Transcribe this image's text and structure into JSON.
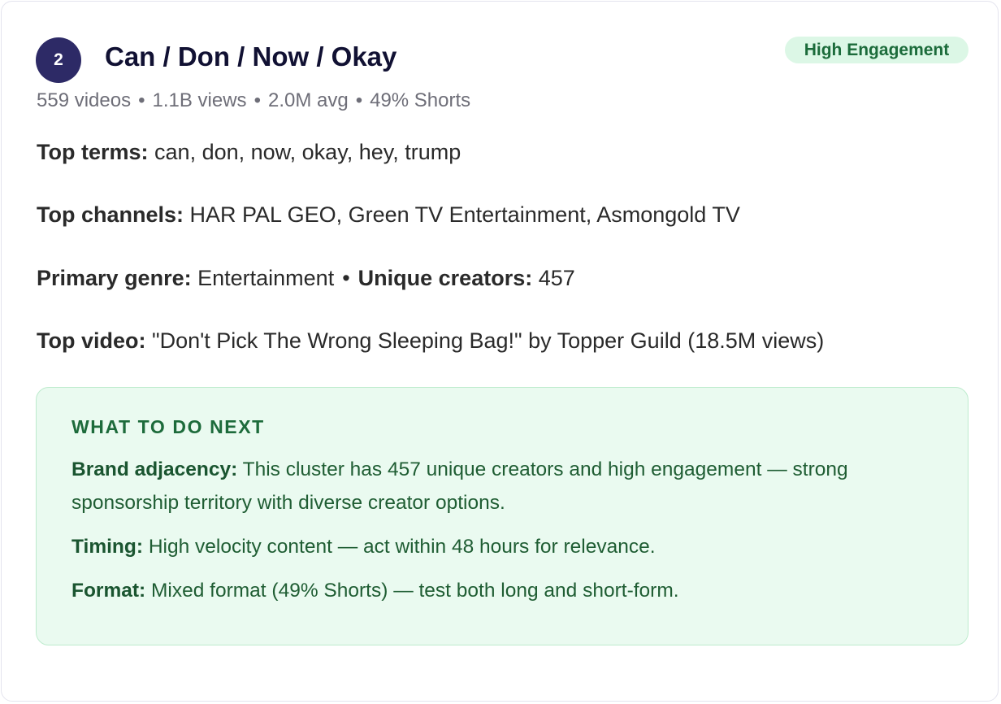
{
  "cluster": {
    "rank": "2",
    "title": "Can / Don / Now / Okay",
    "badge": "High Engagement",
    "stats": {
      "videos": "559 videos",
      "views": "1.1B views",
      "avg": "2.0M avg",
      "shorts": "49% Shorts"
    },
    "separator": "•",
    "top_terms": {
      "label": "Top terms:",
      "value": "can, don, now, okay, hey, trump"
    },
    "top_channels": {
      "label": "Top channels:",
      "value": "HAR PAL GEO, Green TV Entertainment, Asmongold TV"
    },
    "primary_genre": {
      "label": "Primary genre:",
      "value": "Entertainment"
    },
    "unique_creators": {
      "label": "Unique creators:",
      "value": "457"
    },
    "top_video": {
      "label": "Top video:",
      "value": "\"Don't Pick The Wrong Sleeping Bag!\" by Topper Guild (18.5M views)"
    }
  },
  "next_steps": {
    "heading": "WHAT TO DO NEXT",
    "items": [
      {
        "label": "Brand adjacency:",
        "text": "This cluster has 457 unique creators and high engagement — strong sponsorship territory with diverse creator options."
      },
      {
        "label": "Timing:",
        "text": "High velocity content — act within 48 hours for relevance."
      },
      {
        "label": "Format:",
        "text": "Mixed format (49% Shorts) — test both long and short-form."
      }
    ]
  },
  "colors": {
    "rank_badge_bg": "#2d2a66",
    "engagement_badge_bg": "#dcf7e6",
    "engagement_badge_text": "#1b6b3a",
    "next_box_bg": "#eafaf0",
    "next_box_text": "#1f5d33"
  }
}
